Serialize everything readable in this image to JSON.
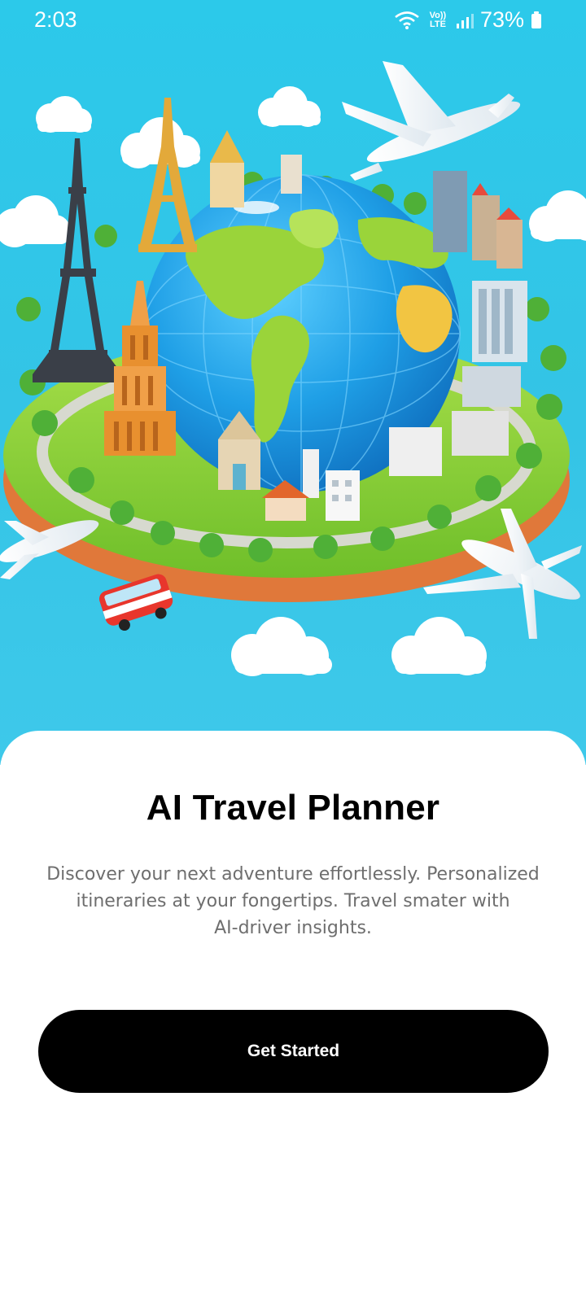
{
  "status_bar": {
    "time": "2:03",
    "network": "Vo)) LTE",
    "battery": "73%"
  },
  "hero": {
    "icon": "travel-globe-illustration",
    "colors": {
      "sky": "#2cc9ea",
      "ocean": "#2aa6e6",
      "land": "#9ad43a"
    }
  },
  "onboarding": {
    "title": "AI Travel Planner",
    "subtitle_line1": "Discover your next adventure effortlessly. Personalized",
    "subtitle_line2": "itineraries at your fongertips. Travel smater with",
    "subtitle_line3": "AI-driver insights.",
    "cta_label": "Get Started"
  }
}
